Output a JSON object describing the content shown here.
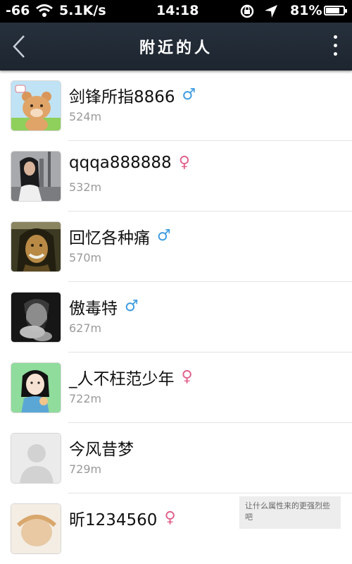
{
  "status_bar": {
    "signal": "-66",
    "network_speed": "5.1K/s",
    "time": "14:18",
    "battery": "81%",
    "battery_level": 0.81,
    "icons": [
      "wifi-icon",
      "rotation-lock-icon",
      "location-icon",
      "battery-icon"
    ]
  },
  "nav": {
    "title": "附近的人",
    "back_icon": "chevron-left-icon",
    "more_icon": "more-vertical-icon"
  },
  "people": [
    {
      "name": "剑锋所指8866",
      "gender": "male",
      "gender_symbol": "♂",
      "distance": "524m"
    },
    {
      "name": "qqqa888888",
      "gender": "female",
      "gender_symbol": "♀",
      "distance": "532m"
    },
    {
      "name": "回忆各种痛",
      "gender": "male",
      "gender_symbol": "♂",
      "distance": "570m"
    },
    {
      "name": "傲毒特",
      "gender": "male",
      "gender_symbol": "♂",
      "distance": "627m"
    },
    {
      "name": "_人不枉范少年",
      "gender": "female",
      "gender_symbol": "♀",
      "distance": "722m"
    },
    {
      "name": "今风昔梦",
      "gender": "",
      "gender_symbol": "",
      "distance": "729m"
    },
    {
      "name": "昕1234560",
      "gender": "female",
      "gender_symbol": "♀",
      "distance": ""
    }
  ],
  "watermark": {
    "text": "让什么属性来的更强烈些吧"
  },
  "colors": {
    "nav_bg": "#1d252f",
    "male": "#3d9be0",
    "female": "#e0608a",
    "distance_text": "#9a9a9a"
  }
}
